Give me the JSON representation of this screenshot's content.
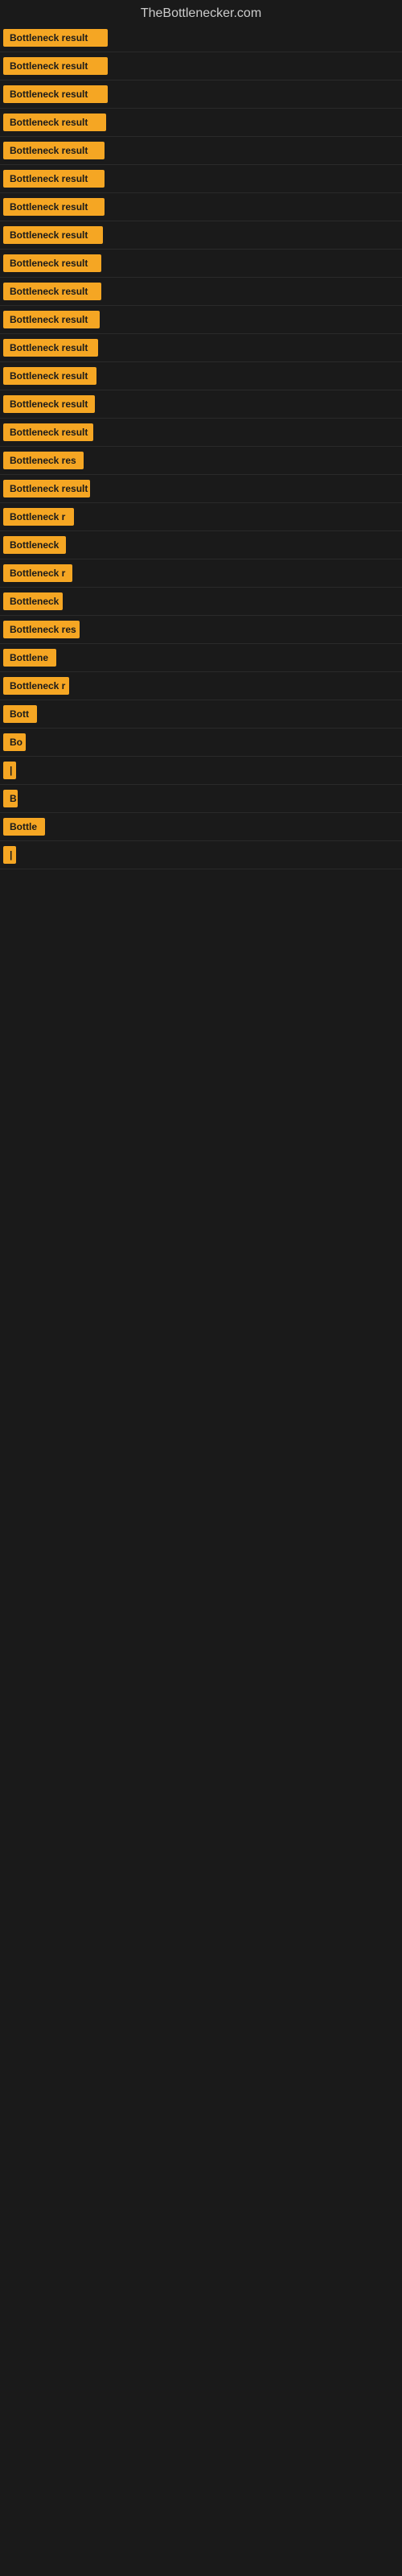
{
  "header": {
    "title": "TheBottlenecker.com"
  },
  "items": [
    {
      "label": "Bottleneck result",
      "width": 130
    },
    {
      "label": "Bottleneck result",
      "width": 130
    },
    {
      "label": "Bottleneck result",
      "width": 130
    },
    {
      "label": "Bottleneck result",
      "width": 128
    },
    {
      "label": "Bottleneck result",
      "width": 126
    },
    {
      "label": "Bottleneck result",
      "width": 126
    },
    {
      "label": "Bottleneck result",
      "width": 126
    },
    {
      "label": "Bottleneck result",
      "width": 124
    },
    {
      "label": "Bottleneck result",
      "width": 122
    },
    {
      "label": "Bottleneck result",
      "width": 122
    },
    {
      "label": "Bottleneck result",
      "width": 120
    },
    {
      "label": "Bottleneck result",
      "width": 118
    },
    {
      "label": "Bottleneck result",
      "width": 116
    },
    {
      "label": "Bottleneck result",
      "width": 114
    },
    {
      "label": "Bottleneck result",
      "width": 112
    },
    {
      "label": "Bottleneck res",
      "width": 100
    },
    {
      "label": "Bottleneck result",
      "width": 108
    },
    {
      "label": "Bottleneck r",
      "width": 88
    },
    {
      "label": "Bottleneck",
      "width": 78
    },
    {
      "label": "Bottleneck r",
      "width": 86
    },
    {
      "label": "Bottleneck",
      "width": 74
    },
    {
      "label": "Bottleneck res",
      "width": 95
    },
    {
      "label": "Bottlene",
      "width": 66
    },
    {
      "label": "Bottleneck r",
      "width": 82
    },
    {
      "label": "Bott",
      "width": 42
    },
    {
      "label": "Bo",
      "width": 28
    },
    {
      "label": "|",
      "width": 10
    },
    {
      "label": "B",
      "width": 18
    },
    {
      "label": "Bottle",
      "width": 52
    },
    {
      "label": "|",
      "width": 10
    }
  ]
}
